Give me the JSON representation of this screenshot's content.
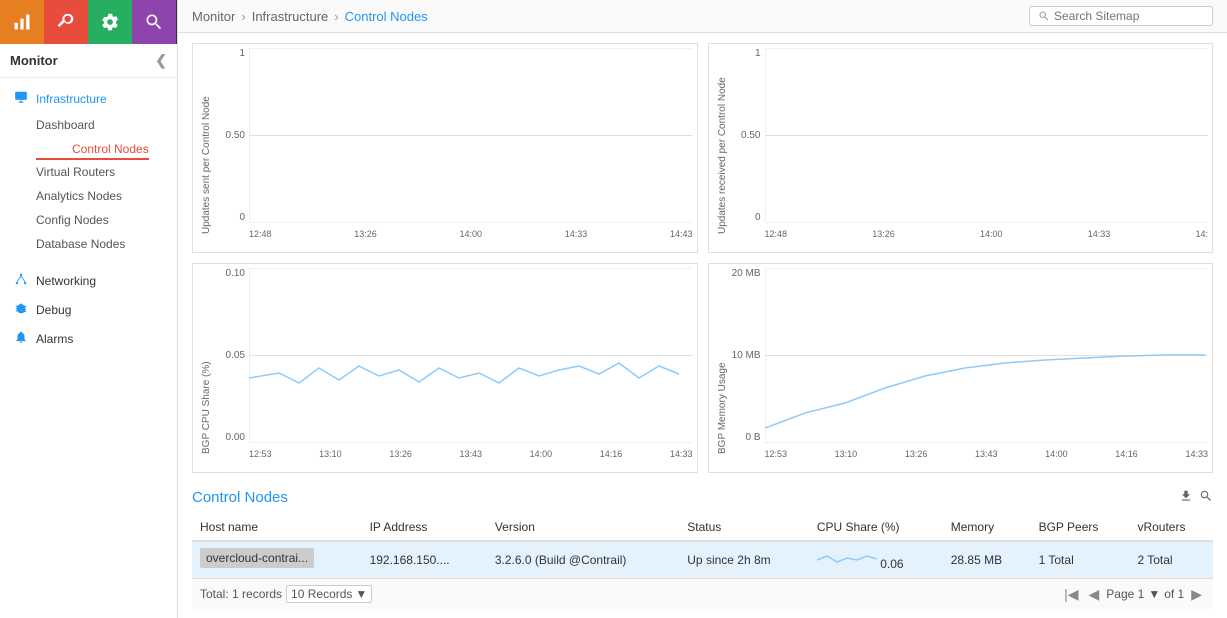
{
  "topIcons": [
    {
      "id": "bar-chart",
      "label": "Dashboard",
      "active": true
    },
    {
      "id": "wrench",
      "label": "Configure"
    },
    {
      "id": "gear",
      "label": "Settings"
    },
    {
      "id": "search",
      "label": "Search"
    }
  ],
  "sidebar": {
    "title": "Monitor",
    "sections": [
      {
        "label": "Infrastructure",
        "icon": "monitor",
        "active": true,
        "children": [
          {
            "label": "Dashboard",
            "active": false
          },
          {
            "label": "Control Nodes",
            "active": true
          },
          {
            "label": "Virtual Routers",
            "active": false
          },
          {
            "label": "Analytics Nodes",
            "active": false
          },
          {
            "label": "Config Nodes",
            "active": false
          },
          {
            "label": "Database Nodes",
            "active": false
          }
        ]
      },
      {
        "label": "Networking",
        "icon": "network",
        "active": false
      },
      {
        "label": "Debug",
        "icon": "debug",
        "active": false
      },
      {
        "label": "Alarms",
        "icon": "bell",
        "active": false
      }
    ]
  },
  "breadcrumb": {
    "items": [
      "Monitor",
      "Infrastructure",
      "Control Nodes"
    ]
  },
  "search": {
    "placeholder": "Search Sitemap"
  },
  "charts": [
    {
      "id": "chart-updates-sent",
      "yLabel": "Updates sent per Control Node",
      "yValues": [
        "1",
        "0.50",
        "0"
      ],
      "xValues": [
        "12:48",
        "13:26",
        "14:00",
        "14:33",
        "14:43"
      ],
      "hasData": false
    },
    {
      "id": "chart-updates-received",
      "yLabel": "Updates received per Control Node",
      "yValues": [
        "1",
        "0.50",
        "0"
      ],
      "xValues": [
        "12:48",
        "13:26",
        "14:00",
        "14:33",
        "14:"
      ],
      "hasData": false
    },
    {
      "id": "chart-bgp-cpu",
      "yLabel": "BGP CPU Share (%)",
      "yValues": [
        "0.10",
        "0.05",
        "0.00"
      ],
      "xValues": [
        "12:53",
        "13:10",
        "13:26",
        "13:43",
        "14:00",
        "14:16",
        "14:33"
      ],
      "hasData": true
    },
    {
      "id": "chart-bgp-memory",
      "yLabel": "BGP Memory Usage",
      "yValues": [
        "20 MB",
        "10 MB",
        "0 B"
      ],
      "xValues": [
        "12:53",
        "13:10",
        "13:26",
        "13:43",
        "14:00",
        "14:16",
        "14:33"
      ],
      "hasData": true
    }
  ],
  "tableSection": {
    "title": "Control Nodes",
    "columns": [
      "Host name",
      "IP Address",
      "Version",
      "Status",
      "CPU Share (%)",
      "Memory",
      "BGP Peers",
      "vRouters"
    ],
    "rows": [
      {
        "hostname": "overcloud-contrai...",
        "ip": "192.168.150....",
        "version": "3.2.6.0 (Build @Contrail)",
        "status": "Up since 2h 8m",
        "cpuShare": "0.06",
        "memory": "28.85 MB",
        "bgpPeers": "1 Total",
        "vRouters": "2 Total"
      }
    ],
    "footer": {
      "totalLabel": "Total: 1 records",
      "recordsLabel": "10 Records",
      "pageLabel": "Page 1",
      "ofLabel": "of 1"
    }
  }
}
